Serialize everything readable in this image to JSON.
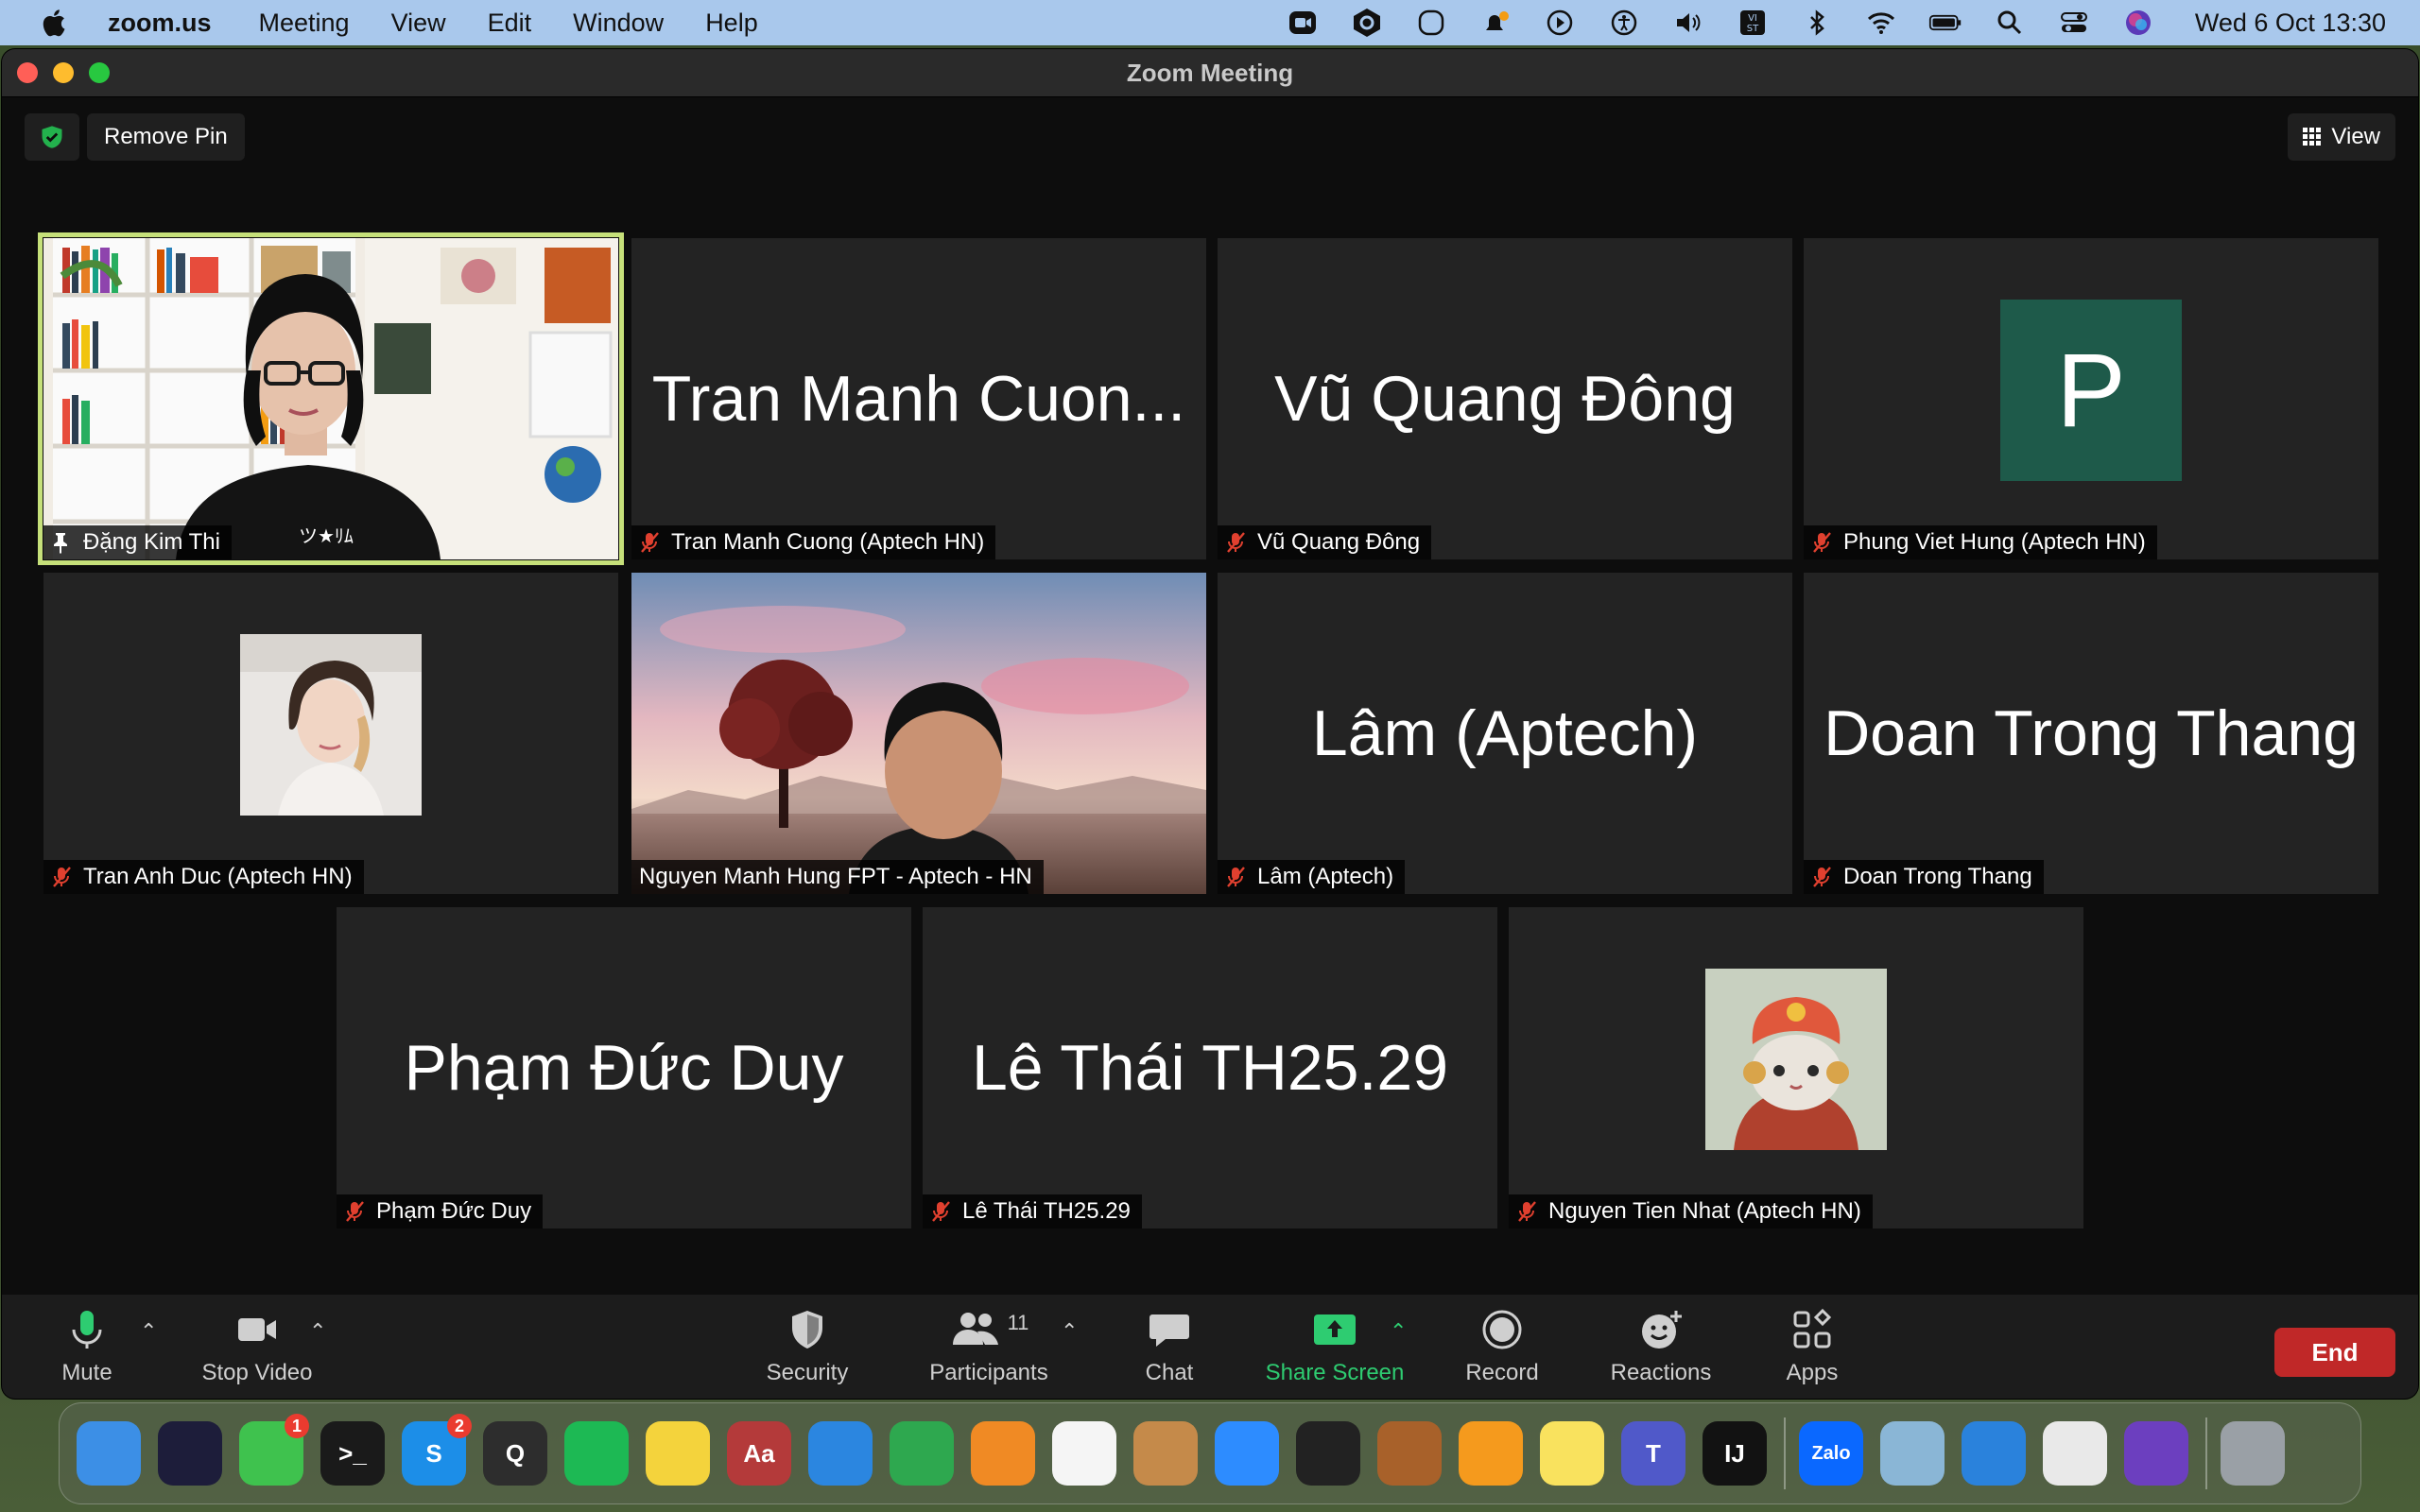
{
  "menubar": {
    "app_name": "zoom.us",
    "menus": [
      "Meeting",
      "View",
      "Edit",
      "Window",
      "Help"
    ],
    "clock": "Wed 6 Oct  13:30",
    "status_icons": [
      "zoom-camera-icon",
      "hexagon-icon",
      "rounded-square-icon",
      "notification-icon",
      "play-icon",
      "accessibility-icon",
      "volume-icon",
      "input-method-icon",
      "bluetooth-icon",
      "wifi-icon",
      "battery-icon",
      "search-icon",
      "control-center-icon",
      "siri-icon"
    ],
    "input_method_label": "VI\nST"
  },
  "window": {
    "title": "Zoom Meeting",
    "remove_pin_label": "Remove Pin",
    "view_label": "View"
  },
  "tiles": [
    {
      "id": "dang-kim-thi",
      "display": "",
      "label": "Đặng Kim Thi",
      "type": "video",
      "pinned": true
    },
    {
      "id": "tran-manh-cuong",
      "display": "Tran Manh Cuon...",
      "label": "Tran Manh Cuong (Aptech HN)",
      "type": "name",
      "muted": true
    },
    {
      "id": "vu-quang-dong",
      "display": "Vũ Quang Đông",
      "label": "Vũ Quang Đông",
      "type": "name",
      "muted": true
    },
    {
      "id": "phung-viet-hung",
      "display": "P",
      "label": "Phung Viet Hung (Aptech HN)",
      "type": "avatar-letter",
      "muted": true
    },
    {
      "id": "tran-anh-duc",
      "display": "",
      "label": "Tran Anh Duc (Aptech HN)",
      "type": "avatar-photo",
      "muted": true
    },
    {
      "id": "nguyen-manh-hung",
      "display": "",
      "label": "Nguyen Manh Hung FPT - Aptech - HN",
      "type": "video",
      "muted": false
    },
    {
      "id": "lam-aptech",
      "display": "Lâm (Aptech)",
      "label": "Lâm (Aptech)",
      "type": "name",
      "muted": true
    },
    {
      "id": "doan-trong-thang",
      "display": "Doan Trong Thang",
      "label": "Doan Trong Thang",
      "type": "name",
      "muted": true
    },
    {
      "id": "pham-duc-duy",
      "display": "Phạm Đức Duy",
      "label": "Phạm Đức Duy",
      "type": "name",
      "muted": true
    },
    {
      "id": "le-thai",
      "display": "Lê Thái TH25.29",
      "label": "Lê Thái TH25.29",
      "type": "name",
      "muted": true
    },
    {
      "id": "nguyen-tien-nhat",
      "display": "",
      "label": "Nguyen Tien Nhat (Aptech HN)",
      "type": "avatar-cat",
      "muted": true
    }
  ],
  "toolbar": {
    "mute": "Mute",
    "stop_video": "Stop Video",
    "security": "Security",
    "participants": "Participants",
    "participants_count": "11",
    "chat": "Chat",
    "share_screen": "Share Screen",
    "record": "Record",
    "reactions": "Reactions",
    "apps": "Apps",
    "end": "End"
  },
  "dock": {
    "apps": [
      {
        "name": "finder",
        "glyph": "",
        "color": "#3c8fe6"
      },
      {
        "name": "siri",
        "glyph": "",
        "color": "#1d1d3a"
      },
      {
        "name": "messages",
        "glyph": "",
        "color": "#3fc24e",
        "badge": "1"
      },
      {
        "name": "terminal",
        "glyph": ">_",
        "color": "#1a1a1a"
      },
      {
        "name": "skype",
        "glyph": "S",
        "color": "#1c8ee8",
        "badge": "2"
      },
      {
        "name": "quicktime",
        "glyph": "Q",
        "color": "#2d2d2d"
      },
      {
        "name": "spotify",
        "glyph": "",
        "color": "#1db954"
      },
      {
        "name": "cyberduck",
        "glyph": "",
        "color": "#f4d33c"
      },
      {
        "name": "dictionary",
        "glyph": "Aa",
        "color": "#b43a3a"
      },
      {
        "name": "safari",
        "glyph": "",
        "color": "#2b86e0"
      },
      {
        "name": "numbers",
        "glyph": "",
        "color": "#2ea84f"
      },
      {
        "name": "books",
        "glyph": "",
        "color": "#f08a24"
      },
      {
        "name": "photos",
        "glyph": "",
        "color": "#f5f5f5"
      },
      {
        "name": "archive-utility",
        "glyph": "",
        "color": "#c58a4a"
      },
      {
        "name": "zoom",
        "glyph": "",
        "color": "#2d8cff"
      },
      {
        "name": "activity-monitor",
        "glyph": "",
        "color": "#222"
      },
      {
        "name": "reeder",
        "glyph": "",
        "color": "#a8612a"
      },
      {
        "name": "pages",
        "glyph": "",
        "color": "#f59a1d"
      },
      {
        "name": "notes",
        "glyph": "",
        "color": "#f9e25e"
      },
      {
        "name": "teams",
        "glyph": "T",
        "color": "#5059c9"
      },
      {
        "name": "intellij",
        "glyph": "IJ",
        "color": "#121212"
      },
      {
        "name": "zalo",
        "glyph": "Zalo",
        "color": "#0a68ff"
      },
      {
        "name": "preview",
        "glyph": "",
        "color": "#8ab6d6"
      },
      {
        "name": "keynote",
        "glyph": "",
        "color": "#2a82dc"
      },
      {
        "name": "textedit",
        "glyph": "",
        "color": "#e9e9e9"
      },
      {
        "name": "visual-studio",
        "glyph": "",
        "color": "#6c3fbf"
      },
      {
        "name": "trash",
        "glyph": "",
        "color": "#9aa0a6"
      }
    ]
  }
}
